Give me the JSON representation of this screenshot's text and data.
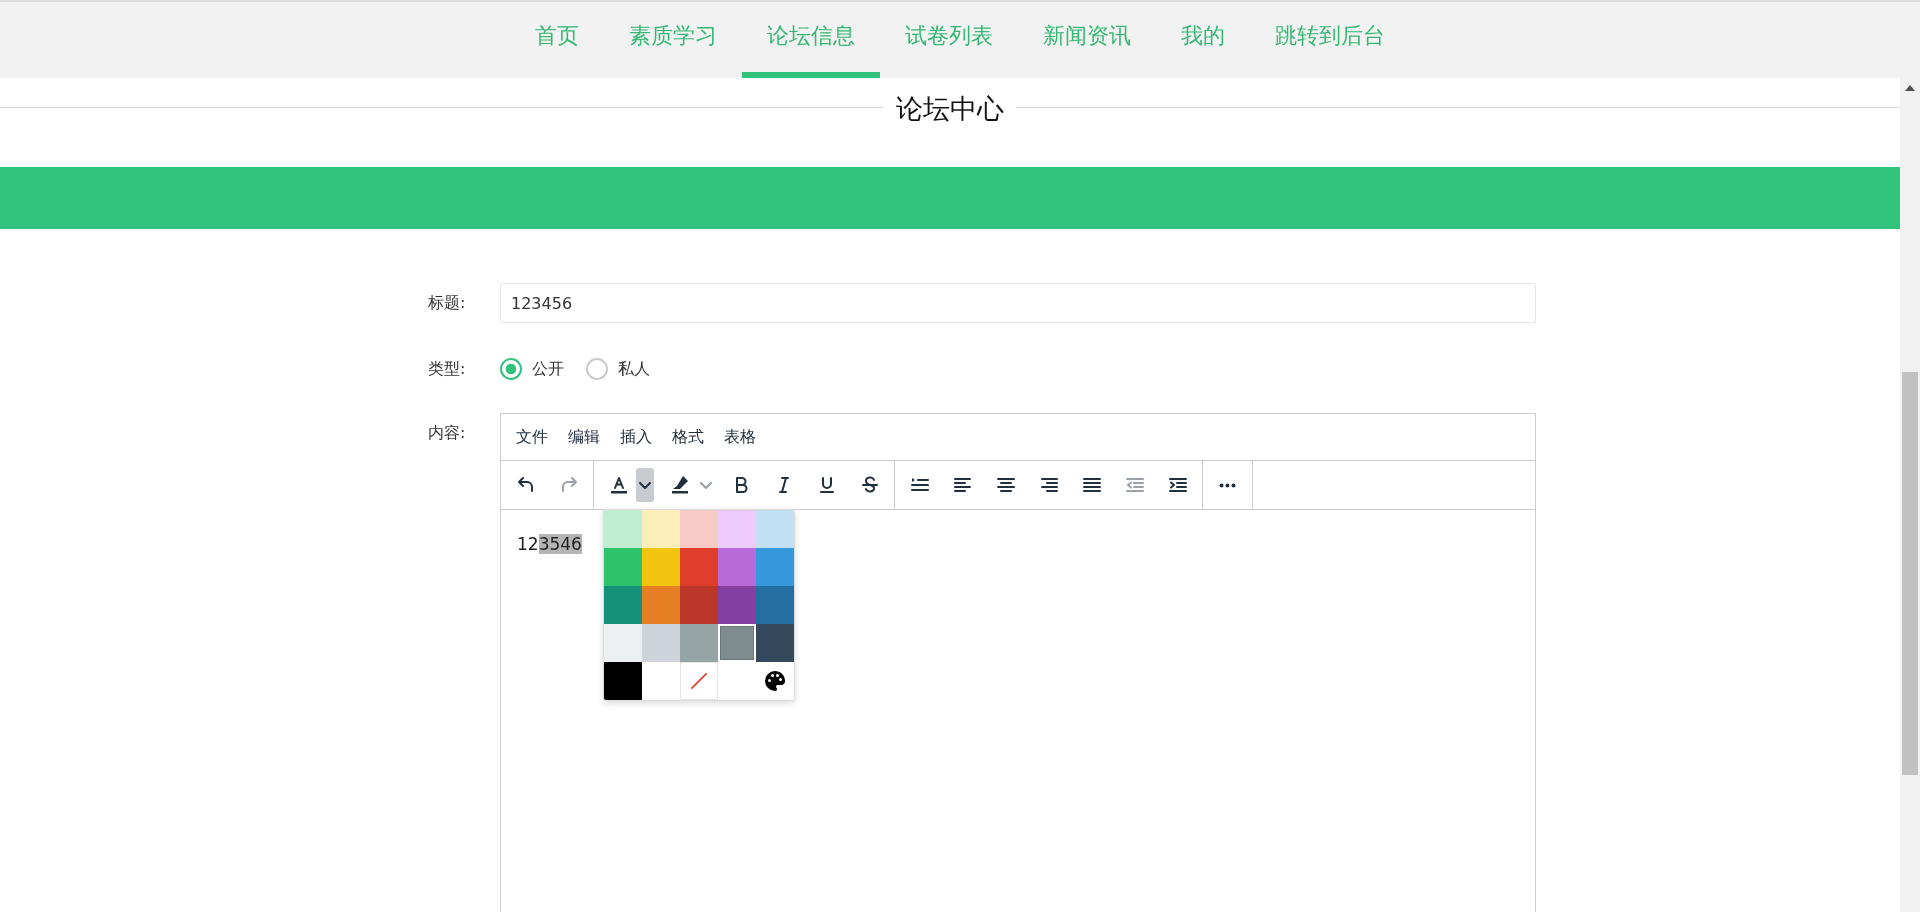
{
  "nav": {
    "items": [
      {
        "label": "首页",
        "selected": false
      },
      {
        "label": "素质学习",
        "selected": false
      },
      {
        "label": "论坛信息",
        "selected": true
      },
      {
        "label": "试卷列表",
        "selected": false
      },
      {
        "label": "新闻资讯",
        "selected": false
      },
      {
        "label": "我的",
        "selected": false
      },
      {
        "label": "跳转到后台",
        "selected": false
      }
    ]
  },
  "page_title": "论坛中心",
  "form": {
    "title_label": "标题:",
    "title_value": "123456",
    "type_label": "类型:",
    "type_options": [
      {
        "label": "公开",
        "selected": true
      },
      {
        "label": "私人",
        "selected": false
      }
    ],
    "content_label": "内容:"
  },
  "editor": {
    "menus": [
      "文件",
      "编辑",
      "插入",
      "格式",
      "表格"
    ],
    "toolbar": [
      [
        {
          "kind": "undo",
          "disabled": false,
          "active": false
        },
        {
          "kind": "redo",
          "disabled": true,
          "active": false
        }
      ],
      [
        {
          "kind": "text-color",
          "disabled": false,
          "active": false
        },
        {
          "kind": "text-color-menu",
          "disabled": false,
          "active": true
        },
        {
          "kind": "highlight",
          "disabled": false,
          "active": false
        },
        {
          "kind": "highlight-menu",
          "disabled": false,
          "active": false
        },
        {
          "kind": "bold",
          "disabled": false,
          "active": false
        },
        {
          "kind": "italic",
          "disabled": false,
          "active": false
        },
        {
          "kind": "underline",
          "disabled": false,
          "active": false
        },
        {
          "kind": "strikethrough",
          "disabled": false,
          "active": false
        }
      ],
      [
        {
          "kind": "line-height",
          "disabled": false,
          "active": false
        },
        {
          "kind": "align-left",
          "disabled": false,
          "active": false
        },
        {
          "kind": "align-center",
          "disabled": false,
          "active": false
        },
        {
          "kind": "align-right",
          "disabled": false,
          "active": false
        },
        {
          "kind": "justify",
          "disabled": false,
          "active": false
        },
        {
          "kind": "outdent",
          "disabled": true,
          "active": false
        },
        {
          "kind": "indent",
          "disabled": false,
          "active": false
        }
      ],
      [
        {
          "kind": "more",
          "disabled": false,
          "active": false
        }
      ]
    ],
    "content": [
      {
        "text": "12",
        "highlighted": false
      },
      {
        "text": "3546",
        "highlighted": true
      }
    ],
    "palette": [
      {
        "kind": "color",
        "color": "#bfedd2",
        "selected": false
      },
      {
        "kind": "color",
        "color": "#fbeeb8",
        "selected": false
      },
      {
        "kind": "color",
        "color": "#f8cac6",
        "selected": false
      },
      {
        "kind": "color",
        "color": "#eccafa",
        "selected": false
      },
      {
        "kind": "color",
        "color": "#c2e0f4",
        "selected": false
      },
      {
        "kind": "color",
        "color": "#2dc26b",
        "selected": false
      },
      {
        "kind": "color",
        "color": "#f1c40f",
        "selected": false
      },
      {
        "kind": "color",
        "color": "#e03e2d",
        "selected": false
      },
      {
        "kind": "color",
        "color": "#b96ad9",
        "selected": false
      },
      {
        "kind": "color",
        "color": "#3598db",
        "selected": false
      },
      {
        "kind": "color",
        "color": "#169179",
        "selected": false
      },
      {
        "kind": "color",
        "color": "#e67e23",
        "selected": false
      },
      {
        "kind": "color",
        "color": "#ba372a",
        "selected": false
      },
      {
        "kind": "color",
        "color": "#843fa1",
        "selected": false
      },
      {
        "kind": "color",
        "color": "#236fa1",
        "selected": false
      },
      {
        "kind": "color",
        "color": "#ecf0f1",
        "selected": false
      },
      {
        "kind": "color",
        "color": "#ced4d9",
        "selected": false
      },
      {
        "kind": "color",
        "color": "#95a5a6",
        "selected": false
      },
      {
        "kind": "color",
        "color": "#7e8c8d",
        "selected": true
      },
      {
        "kind": "color",
        "color": "#34495e",
        "selected": false
      },
      {
        "kind": "color",
        "color": "#000000",
        "selected": false
      },
      {
        "kind": "color",
        "color": "#ffffff",
        "selected": false
      },
      {
        "kind": "remove",
        "selected": false
      },
      {
        "kind": "custom",
        "selected": false
      }
    ]
  }
}
